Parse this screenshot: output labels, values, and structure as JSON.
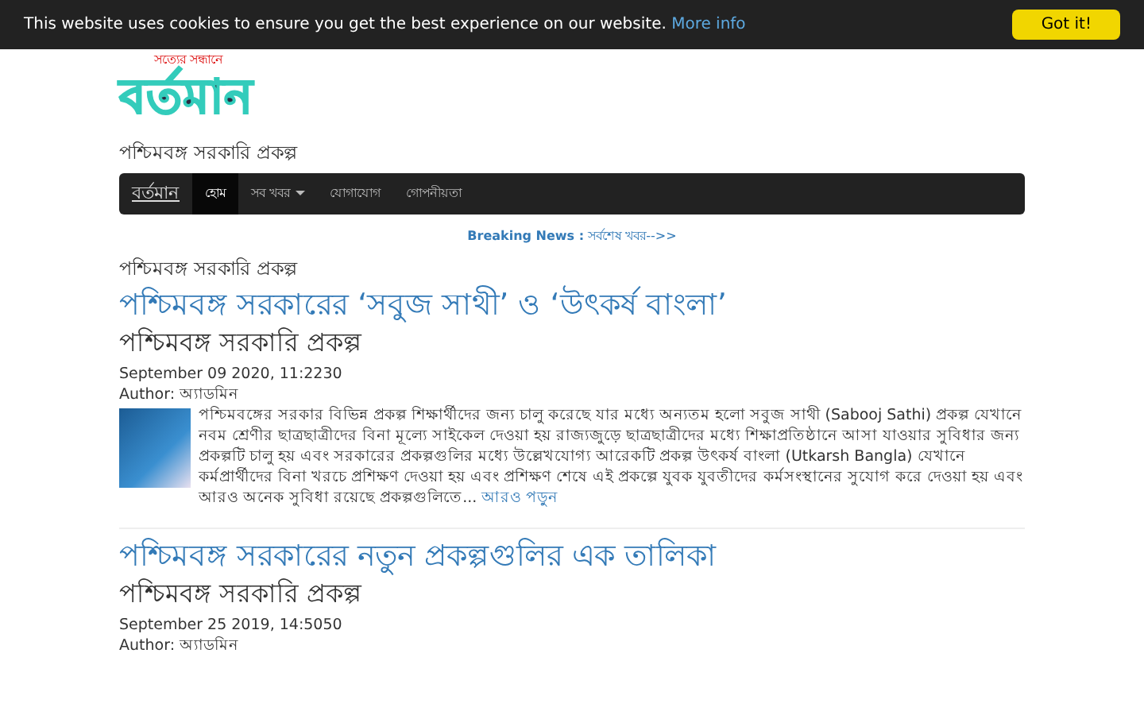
{
  "cookie_bar": {
    "message": "This website uses cookies to ensure you get the best experience on our website.",
    "link": "More info",
    "button": "Got it!"
  },
  "logo": {
    "tagline": "সত্যের সন্ধানে",
    "name": "বর্তমান"
  },
  "site_subtitle": "পশ্চিমবঙ্গ সরকারি প্রকল্প",
  "navbar": {
    "brand": "বর্তমান",
    "items": [
      {
        "label": "হোম",
        "selected": true,
        "dropdown": false
      },
      {
        "label": "সব খবর",
        "selected": false,
        "dropdown": true
      },
      {
        "label": "যোগাযোগ",
        "selected": false,
        "dropdown": false
      },
      {
        "label": "গোপনীয়তা",
        "selected": false,
        "dropdown": false
      }
    ]
  },
  "breaking_news": {
    "label": "Breaking News :",
    "text": "সর্বশেষ খবর-->>"
  },
  "section_title": "পশ্চিমবঙ্গ সরকারি প্রকল্প",
  "articles": [
    {
      "title": "পশ্চিমবঙ্গ সরকারের ‘সবুজ সাথী’ ও ‘উৎকর্ষ বাংলা’",
      "subtitle": "পশ্চিমবঙ্গ সরকারি প্রকল্প",
      "date": "September 09 2020, 11:2230",
      "author": "Author: অ্যাডমিন",
      "has_thumbnail": true,
      "excerpt": "পশ্চিমবঙ্গের সরকার বিভিন্ন প্রকল্প শিক্ষার্থীদের জন্য চালু করেছে যার মধ্যে অন্যতম হলো সবুজ সাথী (Sabooj Sathi) প্রকল্প যেখানে নবম শ্রেণীর ছাত্রছাত্রীদের বিনা মূল্যে সাইকেল দেওয়া হয় রাজ্যজুড়ে ছাত্রছাত্রীদের মধ্যে শিক্ষাপ্রতিষ্ঠানে আসা যাওয়ার সুবিধার জন্য প্রকল্পটি চালু হয় এবং সরকারের প্রকল্পগুলির মধ্যে উল্লেখযোগ্য আরেকটি প্রকল্প উৎকর্ষ বাংলা (Utkarsh Bangla) যেখানে কর্মপ্রার্থীদের বিনা খরচে প্রশিক্ষণ দেওয়া হয় এবং প্রশিক্ষণ শেষে এই প্রকল্পে যুবক যুবতীদের কর্মসংস্থানের সুযোগ করে দেওয়া হয় এবং আরও অনেক সুবিধা রয়েছে প্রকল্পগুলিতে...",
      "read_more": "আরও পড়ুন"
    },
    {
      "title": "পশ্চিমবঙ্গ সরকারের নতুন প্রকল্পগুলির এক তালিকা",
      "subtitle": "পশ্চিমবঙ্গ সরকারি প্রকল্প",
      "date": "September 25 2019, 14:5050",
      "author": "Author: অ্যাডমিন"
    }
  ]
}
